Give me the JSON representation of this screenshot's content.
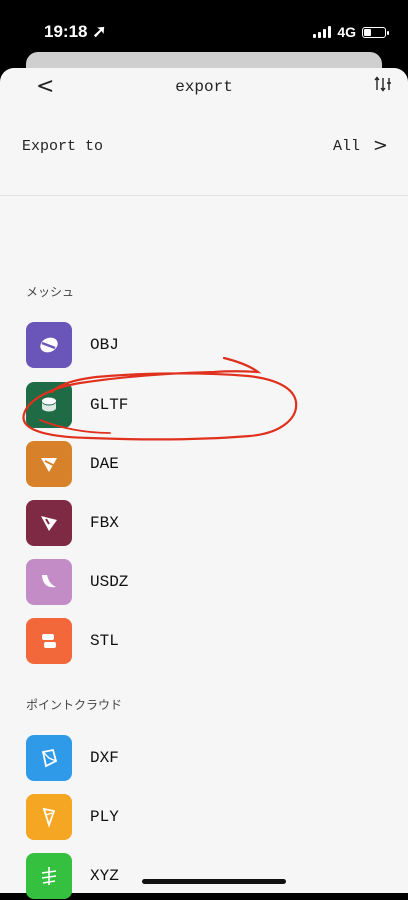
{
  "status": {
    "time": "19:18 ➚",
    "network": "4G"
  },
  "nav": {
    "back": "<",
    "title": "export",
    "sort_icon": "⇅"
  },
  "export_row": {
    "label": "Export to",
    "value": "All",
    "chevron": ">"
  },
  "sections": {
    "mesh": "メッシュ",
    "point_cloud": "ポイントクラウド"
  },
  "formats": {
    "obj": "OBJ",
    "gltf": "GLTF",
    "dae": "DAE",
    "fbx": "FBX",
    "usdz": "USDZ",
    "stl": "STL",
    "dxf": "DXF",
    "ply": "PLY",
    "xyz": "XYZ"
  },
  "colors": {
    "obj": "#6a55b8",
    "gltf": "#1e6b46",
    "dae": "#d7822a",
    "fbx": "#7e2a45",
    "usdz": "#c48cc7",
    "stl": "#f2683a",
    "dxf": "#2f9be8",
    "ply": "#f5a623",
    "xyz": "#35c040",
    "annotation": "#e0301e"
  }
}
